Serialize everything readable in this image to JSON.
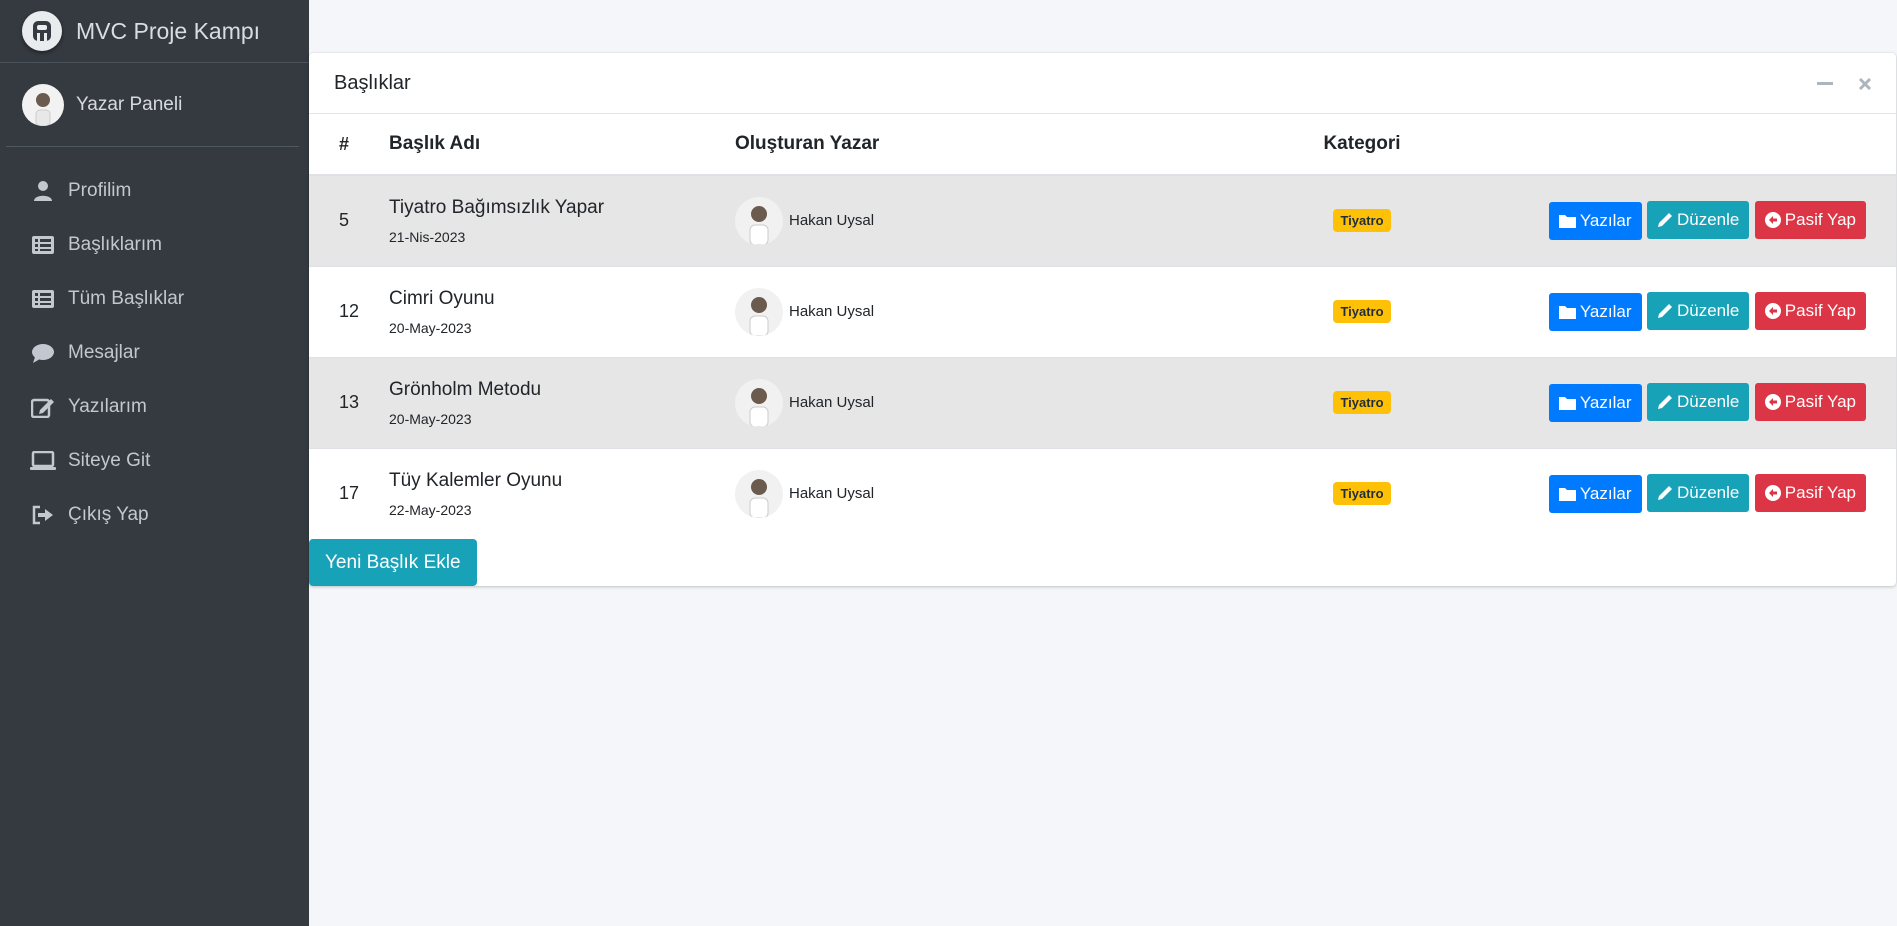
{
  "sidebar": {
    "brand": "MVC Proje Kampı",
    "user_name": "Yazar Paneli",
    "items": [
      {
        "label": "Profilim",
        "icon": "user-icon"
      },
      {
        "label": "Başlıklarım",
        "icon": "list-icon"
      },
      {
        "label": "Tüm Başlıklar",
        "icon": "list-icon"
      },
      {
        "label": "Mesajlar",
        "icon": "comment-icon"
      },
      {
        "label": "Yazılarım",
        "icon": "edit-icon"
      },
      {
        "label": "Siteye Git",
        "icon": "laptop-icon"
      },
      {
        "label": "Çıkış Yap",
        "icon": "sign-out-icon"
      }
    ]
  },
  "card": {
    "title": "Başlıklar",
    "tools": [
      "minus-icon",
      "close-icon"
    ],
    "columns": [
      "#",
      "Başlık Adı",
      "Oluşturan Yazar",
      "Kategori",
      ""
    ],
    "rows": [
      {
        "id": "5",
        "title": "Tiyatro Bağımsızlık Yapar",
        "date": "21-Nis-2023",
        "writer": "Hakan Uysal",
        "category": "Tiyatro"
      },
      {
        "id": "12",
        "title": "Cimri Oyunu",
        "date": "20-May-2023",
        "writer": "Hakan Uysal",
        "category": "Tiyatro"
      },
      {
        "id": "13",
        "title": "Grönholm Metodu",
        "date": "20-May-2023",
        "writer": "Hakan Uysal",
        "category": "Tiyatro"
      },
      {
        "id": "17",
        "title": "Tüy Kalemler Oyunu",
        "date": "22-May-2023",
        "writer": "Hakan Uysal",
        "category": "Tiyatro"
      }
    ],
    "buttons": {
      "posts": "Yazılar",
      "edit": "Düzenle",
      "passive": "Pasif Yap"
    },
    "add_button": "Yeni Başlık Ekle"
  },
  "colors": {
    "sidebar_bg": "#343a40",
    "primary": "#007bff",
    "info": "#17a2b8",
    "danger": "#dc3545",
    "warning": "#ffc107"
  }
}
